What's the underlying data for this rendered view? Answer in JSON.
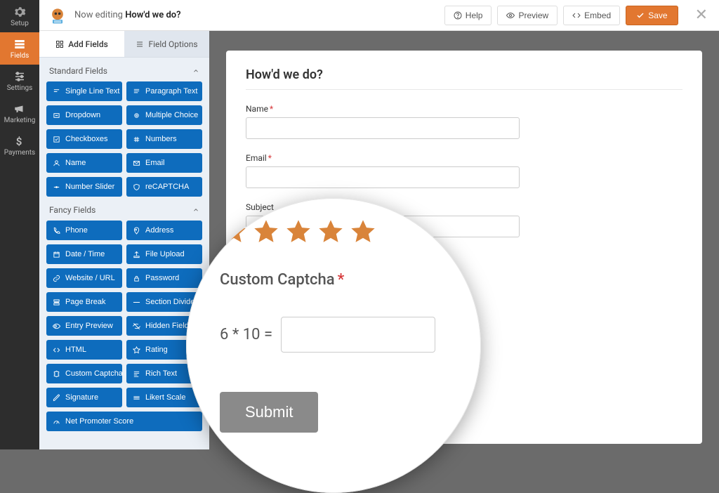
{
  "header": {
    "now_editing_prefix": "Now editing ",
    "form_name": "How'd we do?",
    "help": "Help",
    "preview": "Preview",
    "embed": "Embed",
    "save": "Save"
  },
  "rail": {
    "setup": "Setup",
    "fields": "Fields",
    "settings": "Settings",
    "marketing": "Marketing",
    "payments": "Payments"
  },
  "panel": {
    "tab_add": "Add Fields",
    "tab_options": "Field Options",
    "standard_fields": "Standard Fields",
    "fancy_fields": "Fancy Fields",
    "standard": [
      "Single Line Text",
      "Paragraph Text",
      "Dropdown",
      "Multiple Choice",
      "Checkboxes",
      "Numbers",
      "Name",
      "Email",
      "Number Slider",
      "reCAPTCHA"
    ],
    "fancy": [
      "Phone",
      "Address",
      "Date / Time",
      "File Upload",
      "Website / URL",
      "Password",
      "Page Break",
      "Section Divider",
      "Entry Preview",
      "Hidden Field",
      "HTML",
      "Rating",
      "Custom Captcha",
      "Rich Text",
      "Signature",
      "Likert Scale",
      "Net Promoter Score"
    ]
  },
  "form": {
    "title": "How'd we do?",
    "name_label": "Name",
    "email_label": "Email",
    "subject_label": "Subject"
  },
  "magnify": {
    "captcha_label": "Custom Captcha",
    "equation": "6 * 10 =",
    "submit": "Submit",
    "star_count": 5
  },
  "colors": {
    "accent": "#e27730",
    "chip": "#0e6cbd"
  }
}
